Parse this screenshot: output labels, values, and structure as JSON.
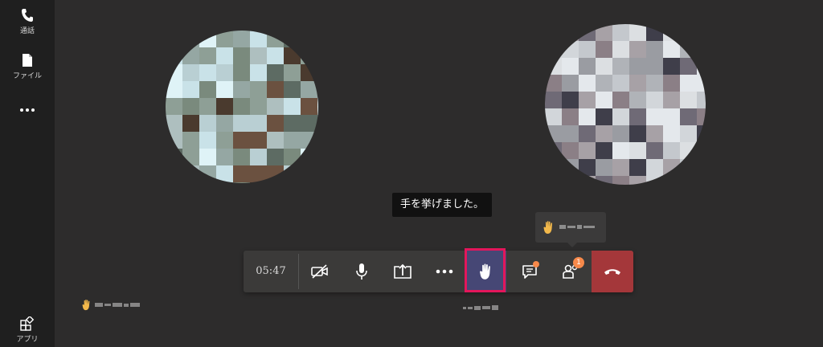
{
  "rail": {
    "items": [
      {
        "label": "通話",
        "icon": "phone-icon"
      },
      {
        "label": "ファイル",
        "icon": "file-icon"
      },
      {
        "label": "",
        "icon": "more-icon"
      },
      {
        "label": "アプリ",
        "icon": "apps-icon"
      }
    ]
  },
  "tooltip": {
    "text": "手を挙げました。"
  },
  "controls": {
    "timer": "05:47",
    "participants_count": "1"
  },
  "colors": {
    "highlight": "#e3165b",
    "raised_hand_bg": "#464775",
    "end_call": "#a4373a",
    "badge": "#f7894a"
  }
}
